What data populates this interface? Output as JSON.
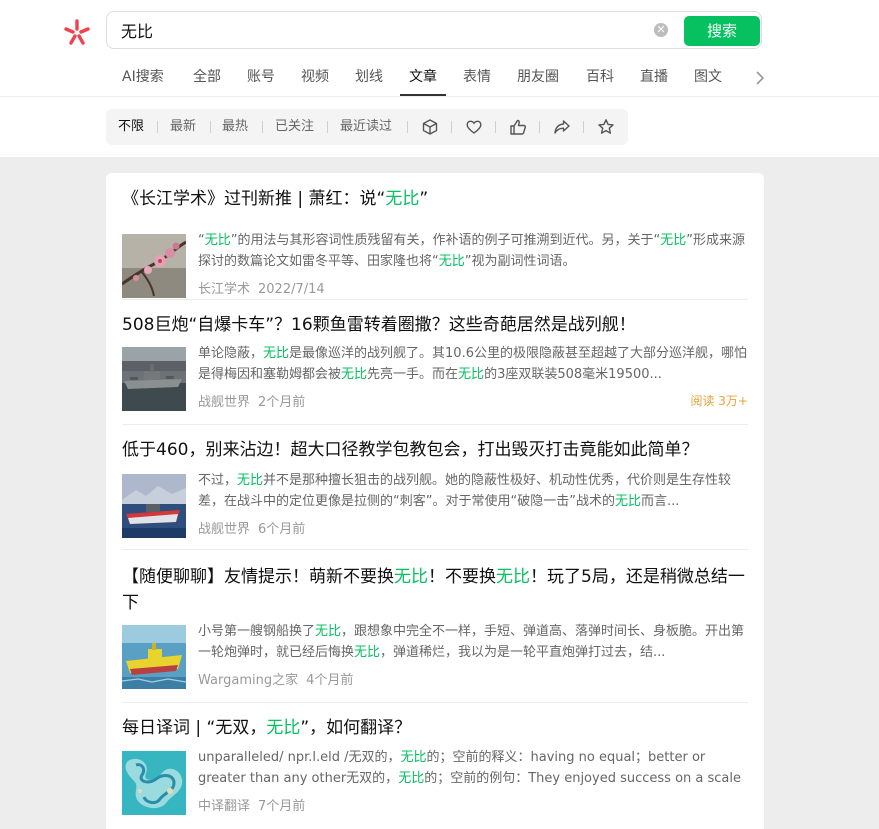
{
  "search": {
    "query": "无比",
    "button_label": "搜索"
  },
  "tabs": [
    "AI搜索",
    "全部",
    "账号",
    "视频",
    "划线",
    "文章",
    "表情",
    "朋友圈",
    "百科",
    "直播",
    "图文"
  ],
  "active_tab": "文章",
  "filters": [
    "不限",
    "最新",
    "最热",
    "已关注",
    "最近读过"
  ],
  "selected_filter": "不限",
  "filter_icons": [
    "box-icon",
    "heart-icon",
    "thumbs-up-icon",
    "share-icon",
    "star-icon"
  ],
  "accent_color": "#07c160",
  "results": [
    {
      "title": [
        {
          "t": "《长江学术》过刊新推 | 萧红：说“"
        },
        {
          "t": "无比",
          "hl": true
        },
        {
          "t": "”"
        }
      ],
      "snippet": [
        {
          "t": "“"
        },
        {
          "t": "无比",
          "hl": true
        },
        {
          "t": "”的用法与其形容词性质残留有关，作补语的例子可推溯到近代。另，关于“"
        },
        {
          "t": "无比",
          "hl": true
        },
        {
          "t": "”形成来源探讨的数篇论文如雷冬平等、田家隆也将“"
        },
        {
          "t": "无比",
          "hl": true
        },
        {
          "t": "”视为副词性词语。"
        }
      ],
      "source": "长江学术",
      "date": "2022/7/14",
      "thumb": "plum-blossom"
    },
    {
      "title": [
        {
          "t": "508巨炮“自爆卡车”？16颗鱼雷转着圈撒？这些奇葩居然是战列舰！"
        }
      ],
      "snippet": [
        {
          "t": "单论隐蔽，"
        },
        {
          "t": "无比",
          "hl": true
        },
        {
          "t": "是最像巡洋的战列舰了。其10.6公里的极限隐蔽甚至超越了大部分巡洋舰，哪怕是得梅因和塞勒姆都会被"
        },
        {
          "t": "无比",
          "hl": true
        },
        {
          "t": "先亮一手。而在"
        },
        {
          "t": "无比",
          "hl": true
        },
        {
          "t": "的3座双联装508毫米19500..."
        }
      ],
      "source": "战舰世界",
      "date": "2个月前",
      "read_count": "阅读 3万+",
      "thumb": "warship-dock"
    },
    {
      "title": [
        {
          "t": "低于460，别来沾边！超大口径教学包教包会，打出毁灭打击竟能如此简单？"
        }
      ],
      "snippet": [
        {
          "t": "不过，"
        },
        {
          "t": "无比",
          "hl": true
        },
        {
          "t": "并不是那种擅长狙击的战列舰。她的隐蔽性极好、机动性优秀，代价则是生存性较差，在战斗中的定位更像是拉侧的“刺客”。对于常使用“破隐一击”战术的"
        },
        {
          "t": "无比",
          "hl": true
        },
        {
          "t": "而言..."
        }
      ],
      "source": "战舰世界",
      "date": "6个月前",
      "thumb": "warship-sea"
    },
    {
      "title": [
        {
          "t": "【随便聊聊】友情提示！萌新不要换"
        },
        {
          "t": "无比",
          "hl": true
        },
        {
          "t": "！不要换"
        },
        {
          "t": "无比",
          "hl": true
        },
        {
          "t": "！玩了5局，还是稍微总结一下"
        }
      ],
      "snippet": [
        {
          "t": "小号第一艘钢船换了"
        },
        {
          "t": "无比",
          "hl": true
        },
        {
          "t": "，跟想象中完全不一样，手短、弹道高、落弹时间长、身板脆。开出第一轮炮弹时，就已经后悔换"
        },
        {
          "t": "无比",
          "hl": true
        },
        {
          "t": "，弹道稀烂，我以为是一轮平直炮弹打过去，结..."
        }
      ],
      "source": "Wargaming之家",
      "date": "4个月前",
      "thumb": "yellow-ship"
    },
    {
      "title": [
        {
          "t": "每日译词 | “无双，"
        },
        {
          "t": "无比",
          "hl": true
        },
        {
          "t": "”，如何翻译？"
        }
      ],
      "snippet": [
        {
          "t": "unparalleled/ npr.l.eld /无双的，"
        },
        {
          "t": "无比",
          "hl": true
        },
        {
          "t": "的；空前的释义：having no equal；better or greater than any other无双的，"
        },
        {
          "t": "无比",
          "hl": true
        },
        {
          "t": "的；空前的例句：They enjoyed success on a scale unpa..."
        }
      ],
      "source": "中译翻译",
      "date": "7个月前",
      "thumb": "reef-aerial"
    }
  ]
}
